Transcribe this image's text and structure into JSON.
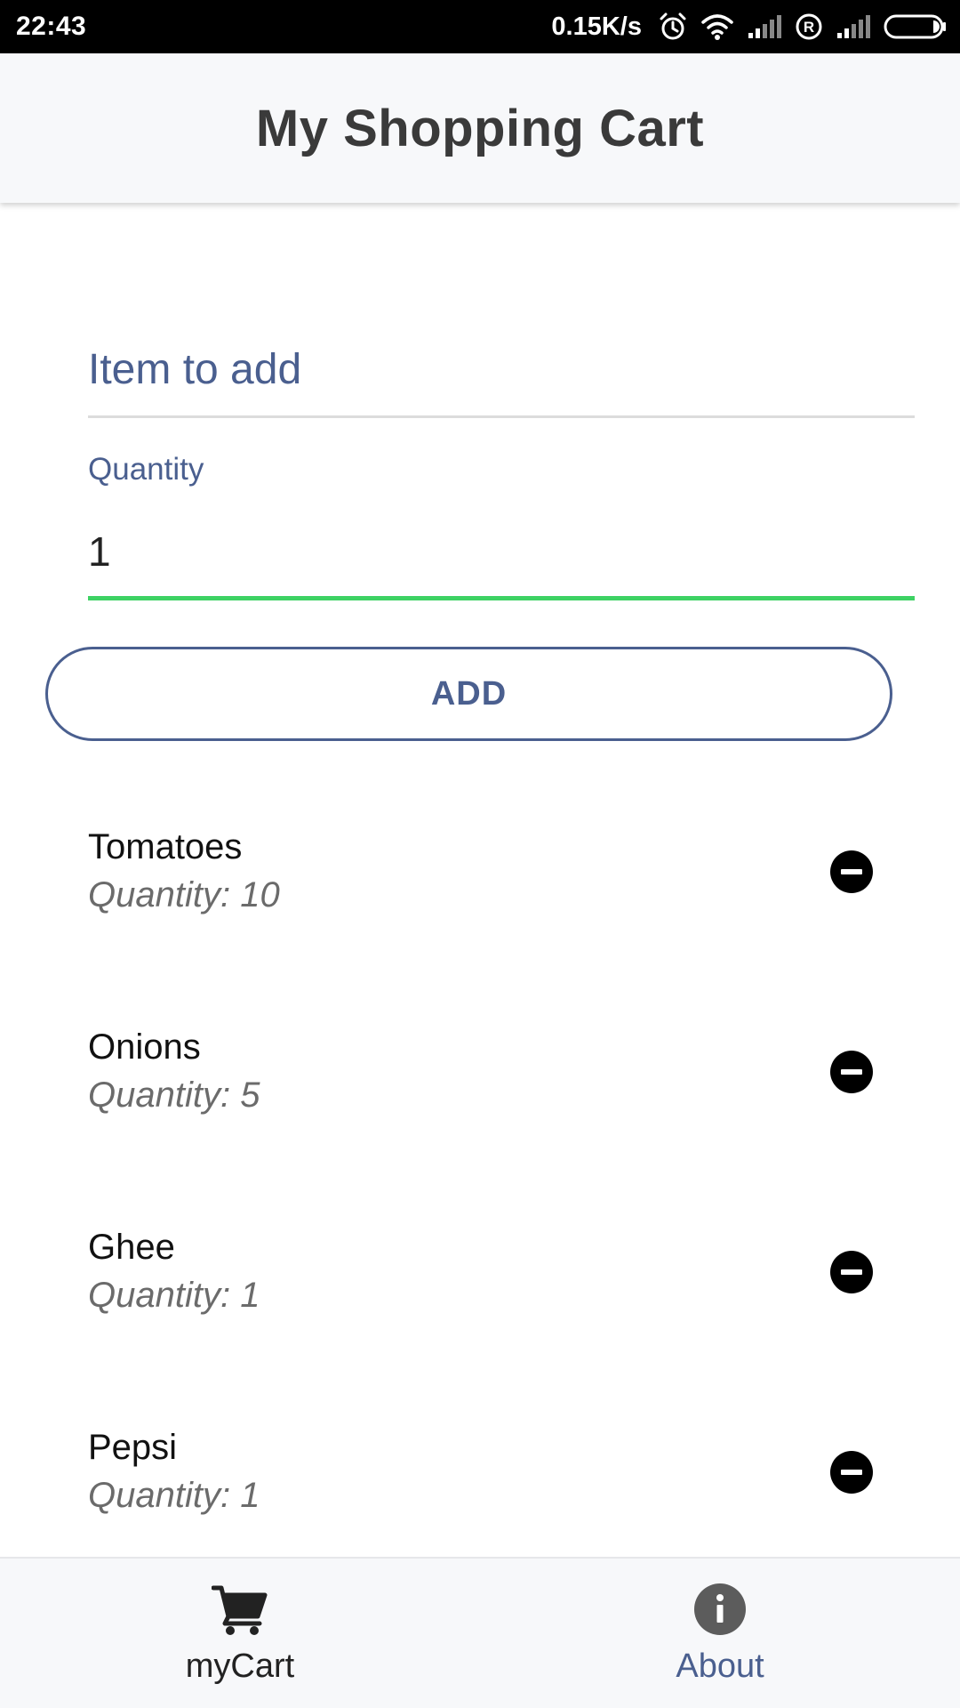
{
  "status_bar": {
    "time": "22:43",
    "network_speed": "0.15K/s",
    "icons": [
      "alarm-icon",
      "wifi-icon",
      "signal-icon",
      "roaming-icon",
      "signal-icon",
      "battery-icon"
    ]
  },
  "header": {
    "title": "My Shopping Cart"
  },
  "form": {
    "item_placeholder": "Item to add",
    "item_value": "",
    "quantity_label": "Quantity",
    "quantity_value": "1",
    "add_label": "ADD"
  },
  "cart": {
    "items": [
      {
        "name": "Tomatoes",
        "quantity_text": "Quantity: 10",
        "remove_icon": "minus-circle-icon"
      },
      {
        "name": "Onions",
        "quantity_text": "Quantity: 5",
        "remove_icon": "minus-circle-icon"
      },
      {
        "name": "Ghee",
        "quantity_text": "Quantity: 1",
        "remove_icon": "minus-circle-icon"
      },
      {
        "name": "Pepsi",
        "quantity_text": "Quantity: 1",
        "remove_icon": "minus-circle-icon"
      }
    ]
  },
  "bottom_nav": {
    "tabs": [
      {
        "label": "myCart",
        "icon": "cart-icon",
        "active": true
      },
      {
        "label": "About",
        "icon": "info-icon",
        "active": false
      }
    ]
  },
  "colors": {
    "accent": "#4a5f8f",
    "focus_underline": "#3dd263",
    "status_bar": "#000000",
    "header_bg": "#f7f8fa"
  }
}
